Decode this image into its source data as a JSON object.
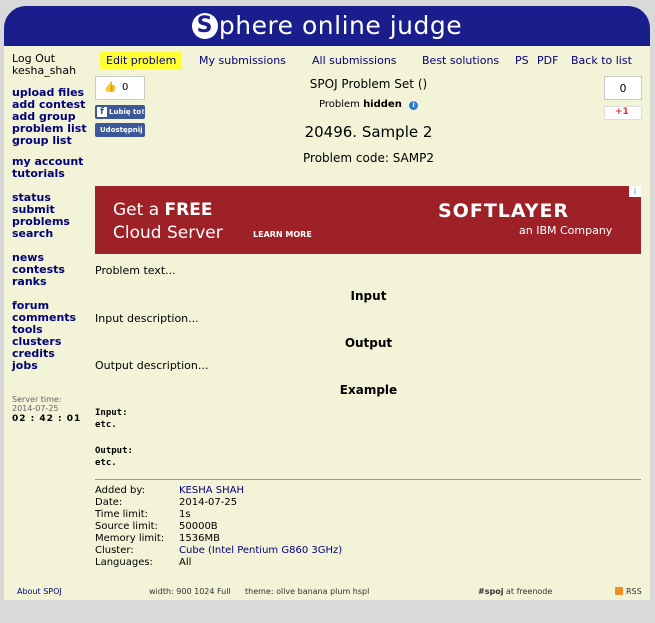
{
  "header": {
    "logo_letter": "S",
    "logo_text": "phere online judge"
  },
  "sidebar": {
    "top": [
      "Log Out",
      "kesha_shah"
    ],
    "group1": [
      "upload files",
      "add contest",
      "add group",
      "problem list",
      "group list"
    ],
    "group2": [
      "my account",
      "tutorials"
    ],
    "group3": [
      "status",
      "submit",
      "problems",
      "search"
    ],
    "group4": [
      "news",
      "contests",
      "ranks"
    ],
    "group5": [
      "forum",
      "comments",
      "tools",
      "clusters",
      "credits",
      "jobs"
    ],
    "server_time_label": [
      "Server time:",
      "2014-07-25"
    ],
    "server_time_value": "02 : 42 : 01"
  },
  "tabs": {
    "edit": "Edit problem",
    "my_submissions": "My submissions",
    "all_submissions": "All submissions",
    "best_solutions": "Best solutions",
    "ps": "PS",
    "pdf": "PDF",
    "back": "Back to list"
  },
  "social": {
    "like_count": "0",
    "fb_like": "Lubię to!",
    "fb_share": "Udostępnij",
    "plus_count": "0",
    "gplus": "+1"
  },
  "problem": {
    "set": "SPOJ Problem Set ()",
    "status_prefix": "Problem",
    "status_value": "hidden",
    "title": "20496. Sample 2",
    "code_line": "Problem code: SAMP2",
    "text": "Problem text...",
    "input_heading": "Input",
    "input_desc": "Input description...",
    "output_heading": "Output",
    "output_desc": "Output description...",
    "example_heading": "Example",
    "example": [
      "Input:",
      "etc.",
      "",
      "Output:",
      "etc."
    ]
  },
  "ad": {
    "line1_prefix": "Get a ",
    "line1_bold": "FREE",
    "line2": "Cloud Server",
    "cta": "LEARN MORE",
    "brand": "SOFTLAYER",
    "brand_sub": "an IBM Company"
  },
  "info": {
    "labels": [
      "Added by:",
      "Date:",
      "Time limit:",
      "Source limit:",
      "Memory limit:",
      "Cluster:",
      "Languages:"
    ],
    "values": [
      "KESHA SHAH",
      "2014-07-25",
      "1s",
      "50000B",
      "1536MB",
      "Cube (Intel Pentium G860 3GHz)",
      "All"
    ]
  },
  "footer": {
    "about": "About SPOJ",
    "width": "width: 900 1024 Full",
    "theme": "theme: olive banana plum hspl",
    "irc_bold": "#spoj",
    "irc_rest": "at freenode",
    "rss": "RSS"
  },
  "colors": {
    "header": "#1a1d8c",
    "panel": "#f3f3d8",
    "link": "#00007a",
    "ad": "#9e2128",
    "highlight": "#ffff33"
  }
}
